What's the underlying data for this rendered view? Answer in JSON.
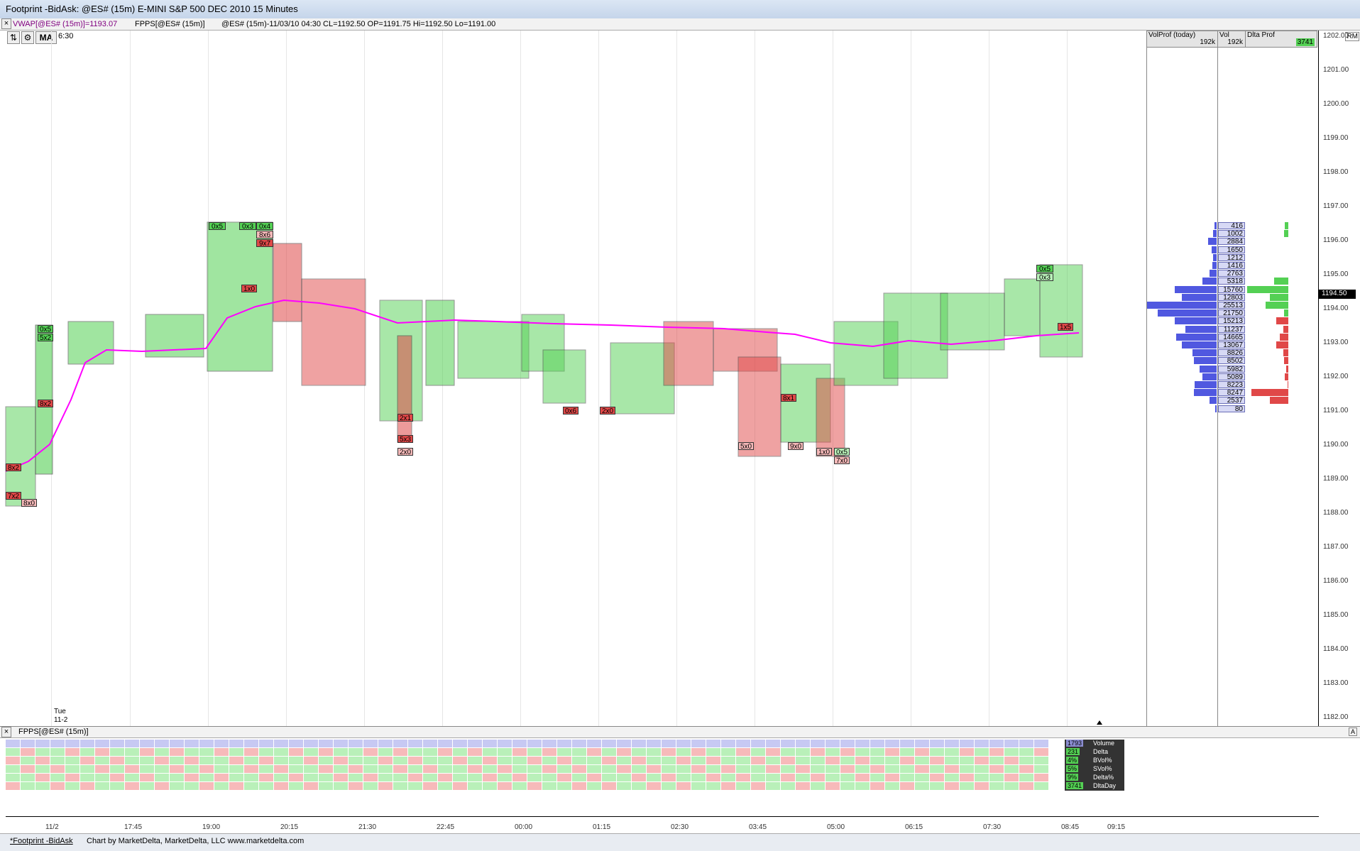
{
  "window": {
    "title": "Footprint  -BidAsk: @ES# (15m) E-MINI S&P 500 DEC 2010 15 Minutes"
  },
  "info_bar": {
    "vwap": "VWAP[@ES# (15m)]=1193.07",
    "fpps": "FPPS[@ES# (15m)]",
    "bar_info": "@ES# (15m)-11/03/10 04:30 CL=1192.50 OP=1191.75 Hi=1192.50 Lo=1191.00"
  },
  "toolbar": {
    "ma_label": "MA",
    "time_label": "6:30"
  },
  "price_axis": {
    "ticks": [
      "1202.00",
      "1201.00",
      "1200.00",
      "1199.00",
      "1198.00",
      "1197.00",
      "1196.00",
      "1195.00",
      "1194.00",
      "1193.00",
      "1192.00",
      "1191.00",
      "1190.00",
      "1189.00",
      "1188.00",
      "1187.00",
      "1186.00",
      "1185.00",
      "1184.00",
      "1183.00",
      "1182.00"
    ],
    "current": "1194.50",
    "corner": "RM"
  },
  "profile": {
    "headers": [
      {
        "name": "VolProf (today)",
        "value": "192k"
      },
      {
        "name": "Vol",
        "value": "192k"
      },
      {
        "name": "Dlta Prof",
        "value": "3741"
      }
    ],
    "volumes": [
      "416",
      "1002",
      "2884",
      "1650",
      "1212",
      "1416",
      "2763",
      "5318",
      "15760",
      "12803",
      "25513",
      "21750",
      "15213",
      "11237",
      "14665",
      "13067",
      "8826",
      "8502",
      "5982",
      "5089",
      "8223",
      "8247",
      "2537",
      "80"
    ],
    "vol_bars": [
      0.03,
      0.05,
      0.12,
      0.07,
      0.05,
      0.06,
      0.1,
      0.2,
      0.6,
      0.5,
      1.0,
      0.85,
      0.6,
      0.45,
      0.58,
      0.5,
      0.35,
      0.33,
      0.24,
      0.2,
      0.32,
      0.33,
      0.1,
      0.02
    ],
    "delta_bars": [
      0.08,
      0.1,
      0,
      0,
      0,
      0,
      0,
      0.35,
      1.0,
      0.45,
      0.55,
      0.1,
      0.3,
      0.12,
      0.2,
      0.3,
      0.12,
      0.1,
      0.05,
      0.08,
      0.02,
      0.9,
      0.45,
      0
    ]
  },
  "date_label": {
    "day": "Tue",
    "date": "11-2"
  },
  "lower_pane": {
    "title": "FPPS[@ES# (15m)]",
    "row_labels": [
      "Volume",
      "Delta",
      "BVol%",
      "SVol%",
      "Delta%",
      "DltaDay"
    ],
    "summary": [
      "1793",
      "231",
      "4%",
      "5%",
      "9%",
      "3741"
    ]
  },
  "time_axis": [
    "11/2",
    "17:45",
    "19:00",
    "20:15",
    "21:30",
    "22:45",
    "00:00",
    "01:15",
    "02:30",
    "03:45",
    "05:00",
    "06:15",
    "07:30",
    "08:45",
    "09:15"
  ],
  "status_bar": {
    "tab": "*Footprint  -BidAsk",
    "credit": "Chart by MarketDelta, MarketDelta, LLC www.marketdelta.com"
  },
  "colors": {
    "vwap": "#ff00ff",
    "buy": "#54d054",
    "sell": "#e04848",
    "profile": "#5058e0",
    "accent": "#000080"
  }
}
